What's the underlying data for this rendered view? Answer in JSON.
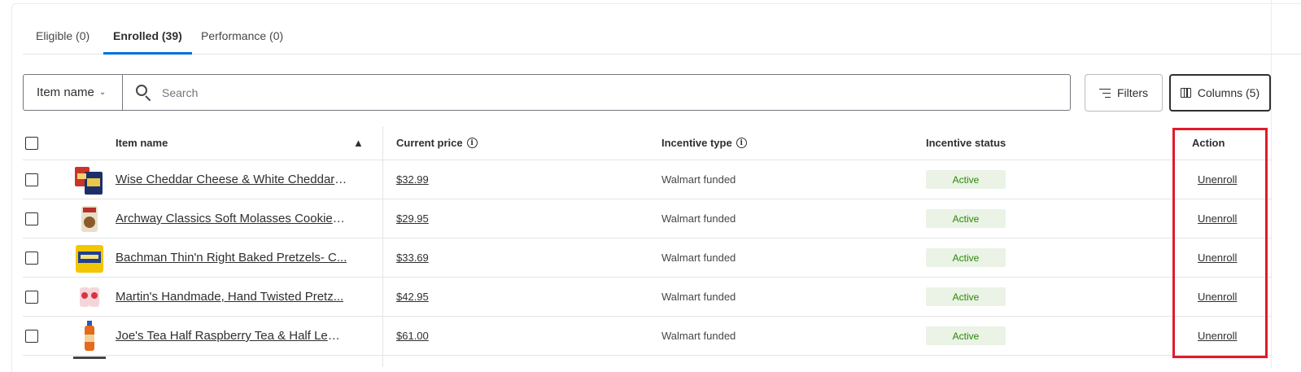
{
  "tabs": [
    {
      "label": "Eligible (0)"
    },
    {
      "label": "Enrolled (39)"
    },
    {
      "label": "Performance (0)"
    }
  ],
  "search": {
    "scope_label": "Item name",
    "placeholder": "Search"
  },
  "toolbar": {
    "filters_label": "Filters",
    "columns_label": "Columns (5)"
  },
  "table": {
    "headers": {
      "item_name": "Item name",
      "current_price": "Current price",
      "incentive_type": "Incentive type",
      "incentive_status": "Incentive status",
      "action": "Action"
    },
    "rows": [
      {
        "name": "Wise Cheddar Cheese & White Cheddar ...",
        "price": "$32.99",
        "incentive_type": "Walmart funded",
        "status": "Active",
        "action": "Unenroll"
      },
      {
        "name": "Archway Classics Soft Molasses Cookies,...",
        "price": "$29.95",
        "incentive_type": "Walmart funded",
        "status": "Active",
        "action": "Unenroll"
      },
      {
        "name": "Bachman Thin'n Right Baked Pretzels- C...",
        "price": "$33.69",
        "incentive_type": "Walmart funded",
        "status": "Active",
        "action": "Unenroll"
      },
      {
        "name": "Martin's Handmade, Hand Twisted Pretz...",
        "price": "$42.95",
        "incentive_type": "Walmart funded",
        "status": "Active",
        "action": "Unenroll"
      },
      {
        "name": "Joe's Tea Half Raspberry Tea & Half Lem...",
        "price": "$61.00",
        "incentive_type": "Walmart funded",
        "status": "Active",
        "action": "Unenroll"
      }
    ]
  },
  "colors": {
    "accent": "#0071dc",
    "status_bg": "#eaf3e6",
    "status_text": "#2a8703",
    "highlight": "#e11a2b"
  }
}
